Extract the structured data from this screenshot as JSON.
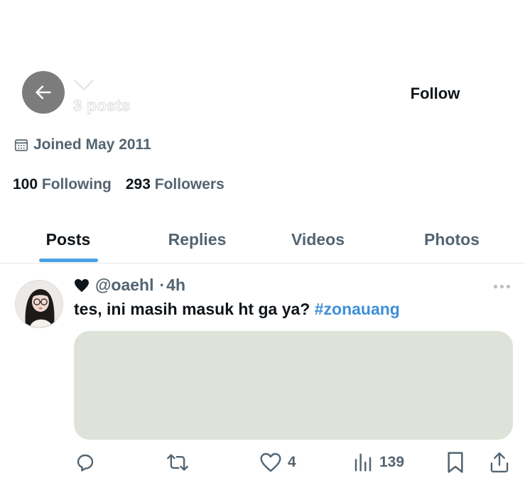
{
  "header": {
    "posts_count": "3 posts",
    "follow_label": "Follow"
  },
  "profile": {
    "joined": "Joined May 2011",
    "following_count": "100",
    "following_label": "Following",
    "followers_count": "293",
    "followers_label": "Followers"
  },
  "tabs": [
    {
      "label": "Posts",
      "active": true
    },
    {
      "label": "Replies",
      "active": false
    },
    {
      "label": "Videos",
      "active": false
    },
    {
      "label": "Photos",
      "active": false
    }
  ],
  "tweet": {
    "name_icon": "heart-icon",
    "handle": "@oaehl",
    "separator": "·",
    "time": "4h",
    "text": "tes, ini masih masuk ht ga ya?",
    "hashtag": "#zonauang",
    "media_color": "#dde3d8",
    "actions": {
      "reply_count": "",
      "retweet_count": "",
      "like_count": "4",
      "views_count": "139"
    }
  },
  "colors": {
    "accent": "#4aa0e4",
    "hashtag": "#3e8fd8",
    "secondary_text": "#536471",
    "back_button": "#7c7c7c"
  }
}
